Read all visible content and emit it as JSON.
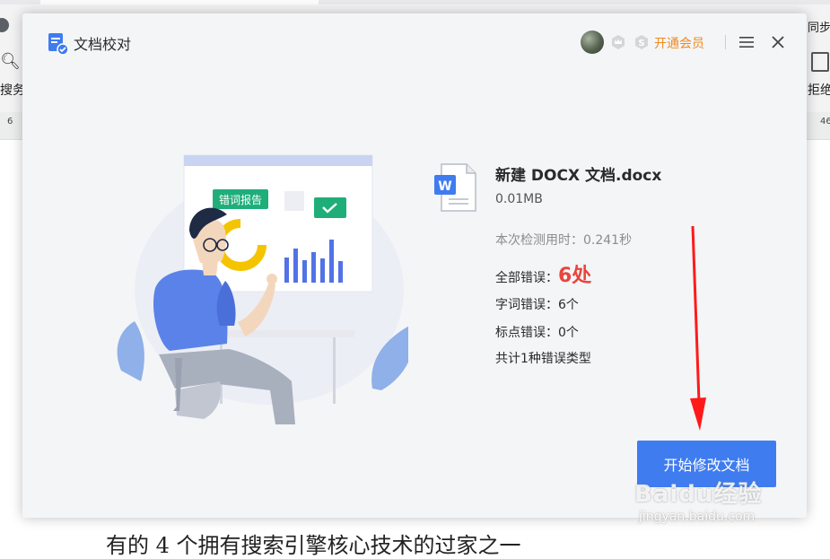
{
  "background": {
    "left_label": "搜务",
    "right_top_text": "同步",
    "right_label": "拒绝",
    "ruler_left": "6",
    "ruler_right": "46",
    "doc_text": "有的 4 个拥有搜索引擎核心技术的过家之一"
  },
  "dialog": {
    "title": "文档校对",
    "vip_label": "开通会员",
    "icons": {
      "title": "document-check-icon",
      "avatar": "avatar",
      "badge1": "crown-badge-icon",
      "badge2": "super-vip-badge-icon",
      "menu": "hamburger-menu-icon",
      "close": "close-icon"
    }
  },
  "illustration": {
    "report_tag": "错词报告"
  },
  "file": {
    "name": "新建 DOCX 文档.docx",
    "size": "0.01MB",
    "icon": "word-file-icon"
  },
  "results": {
    "check_time": "本次检测用时：0.241秒",
    "total_label": "全部错误：",
    "total_value": "6处",
    "word_errors": "字词错误：6个",
    "punctuation_errors": "标点错误：0个",
    "error_types": "共计1种错误类型"
  },
  "action": {
    "start_label": "开始修改文档"
  },
  "overlay": {
    "watermark_main": "Baidu经验",
    "watermark_sub": "jingyan.baidu.com"
  },
  "colors": {
    "accent_blue": "#3f7cf0",
    "vip_orange": "#f08a1f",
    "error_red": "#e8453c",
    "annotation_red": "#ff1a1a",
    "dialog_bg": "#f4f5f7"
  }
}
